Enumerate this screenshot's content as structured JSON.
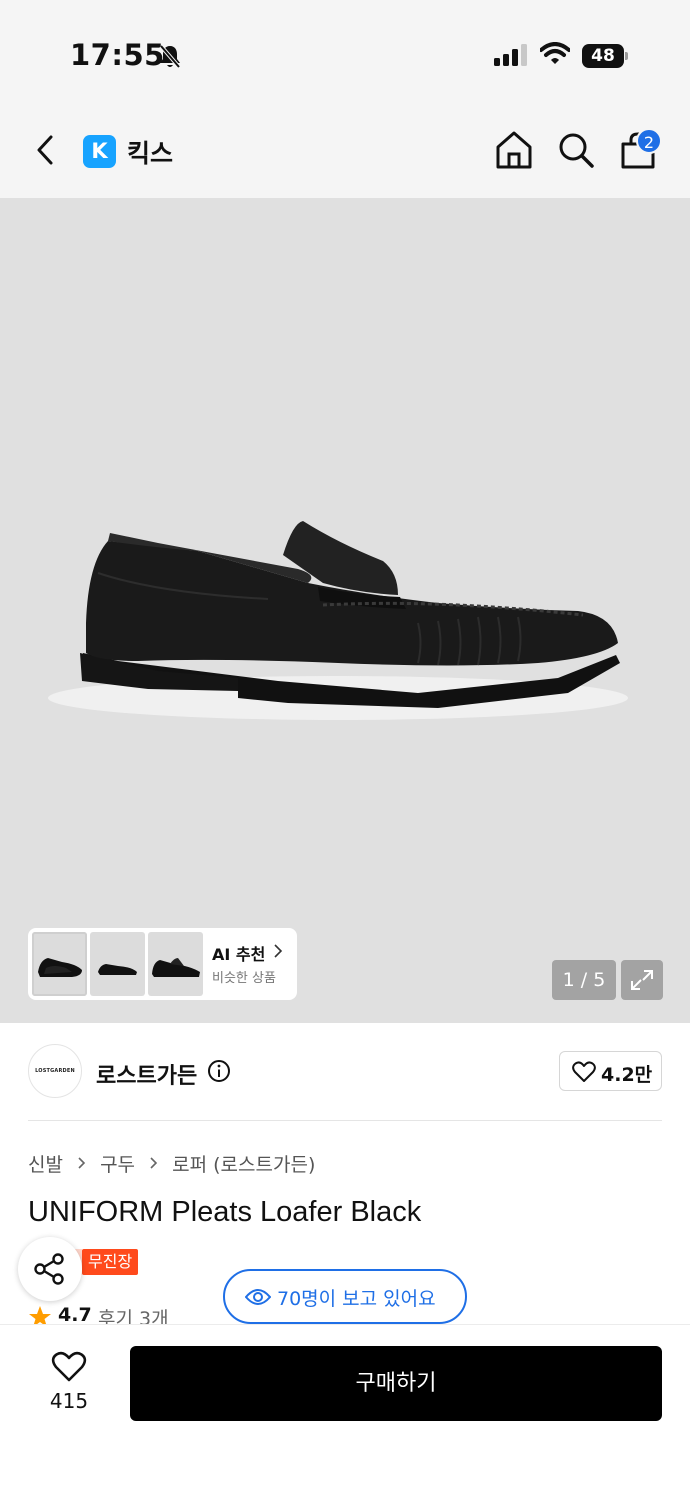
{
  "status_bar": {
    "time": "17:55",
    "battery": "48"
  },
  "nav": {
    "logo_letter": "K",
    "title": "킥스",
    "cart_count": "2"
  },
  "gallery": {
    "ai_title": "AI 추천",
    "ai_subtitle": "비슷한 상품",
    "page_indicator": "1 / 5",
    "current_page": 1,
    "total_pages": 5
  },
  "brand": {
    "logo_text": "LOSTGARDEN",
    "name": "로스트가든",
    "likes": "4.2만"
  },
  "product": {
    "breadcrumb": [
      "신발",
      "구두",
      "로퍼 (로스트가든)"
    ],
    "name": "UNIFORM Pleats Loafer Black",
    "badge": "무진장",
    "viewers": "70명이 보고 있어요",
    "rating": "4.7",
    "reviews": "후기 3개"
  },
  "bottom_bar": {
    "wish_count": "415",
    "buy_label": "구매하기"
  },
  "colors": {
    "accent_blue": "#1f6fe6",
    "badge_orange": "#ff4a1c",
    "logo_blue": "#17a3ff",
    "star": "#ff9d00"
  }
}
